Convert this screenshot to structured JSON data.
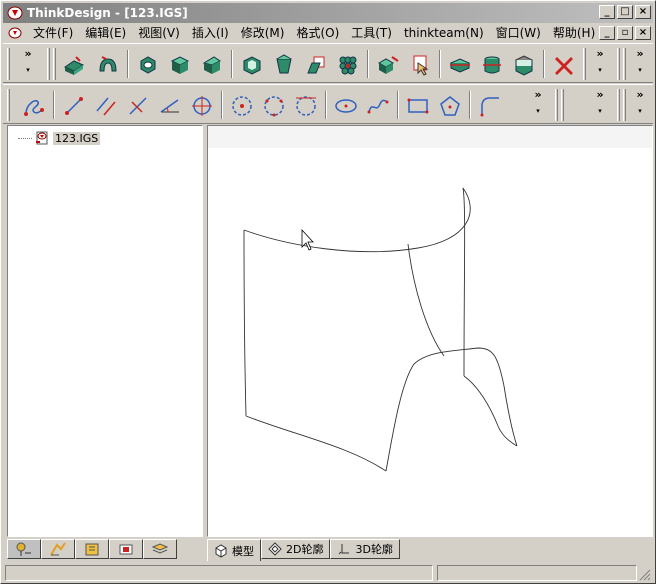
{
  "window": {
    "title": "ThinkDesign  - [123.IGS]",
    "minimize": "_",
    "maximize": "□",
    "close": "×",
    "doc_minimize": "_",
    "doc_restore": "▫",
    "doc_close": "×"
  },
  "menu": {
    "items": [
      {
        "label": "文件(F)"
      },
      {
        "label": "编辑(E)"
      },
      {
        "label": "视图(V)"
      },
      {
        "label": "插入(I)"
      },
      {
        "label": "修改(M)"
      },
      {
        "label": "格式(O)"
      },
      {
        "label": "工具(T)"
      },
      {
        "label": "thinkteam(N)"
      },
      {
        "label": "窗口(W)"
      },
      {
        "label": "帮助(H)"
      }
    ]
  },
  "toolbar": {
    "more": "»",
    "dropdown": "▾"
  },
  "tree": {
    "root_label": "123.IGS"
  },
  "view_tabs": [
    {
      "label": "模型"
    },
    {
      "label": "2D轮廓"
    },
    {
      "label": "3D轮廓"
    }
  ],
  "colors": {
    "solid_green": "#2e8b6a",
    "solid_dark": "#1f5e47",
    "accent_red": "#cc2222",
    "accent_blue": "#3060c0"
  }
}
